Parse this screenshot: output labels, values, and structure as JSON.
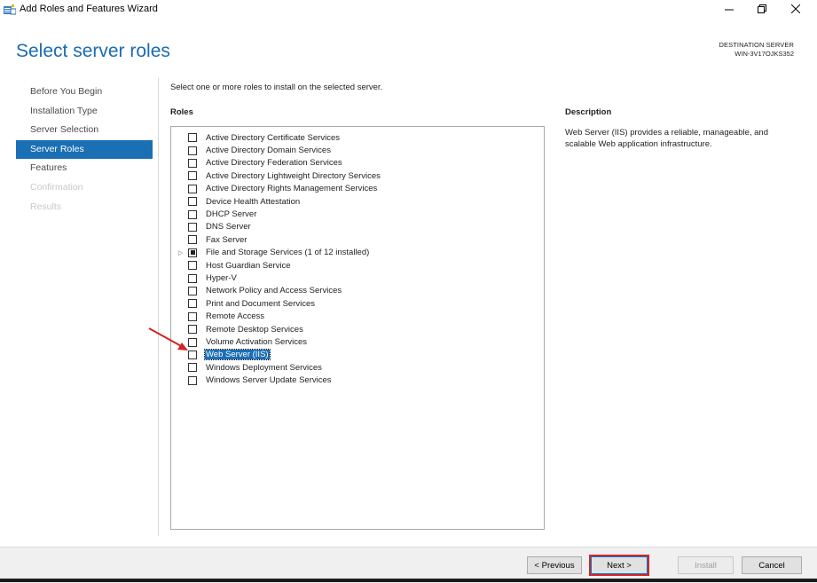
{
  "window": {
    "title": "Add Roles and Features Wizard"
  },
  "header": {
    "page_title": "Select server roles",
    "destination_label": "DESTINATION SERVER",
    "destination_value": "WIN-3V17OJKS352"
  },
  "nav": {
    "items": [
      {
        "label": "Before You Begin",
        "state": "normal"
      },
      {
        "label": "Installation Type",
        "state": "normal"
      },
      {
        "label": "Server Selection",
        "state": "normal"
      },
      {
        "label": "Server Roles",
        "state": "active"
      },
      {
        "label": "Features",
        "state": "normal"
      },
      {
        "label": "Confirmation",
        "state": "disabled"
      },
      {
        "label": "Results",
        "state": "disabled"
      }
    ]
  },
  "main": {
    "instruction": "Select one or more roles to install on the selected server.",
    "roles_heading": "Roles",
    "roles": [
      {
        "label": "Active Directory Certificate Services",
        "checked": false
      },
      {
        "label": "Active Directory Domain Services",
        "checked": false
      },
      {
        "label": "Active Directory Federation Services",
        "checked": false
      },
      {
        "label": "Active Directory Lightweight Directory Services",
        "checked": false
      },
      {
        "label": "Active Directory Rights Management Services",
        "checked": false
      },
      {
        "label": "Device Health Attestation",
        "checked": false
      },
      {
        "label": "DHCP Server",
        "checked": false
      },
      {
        "label": "DNS Server",
        "checked": false
      },
      {
        "label": "Fax Server",
        "checked": false
      },
      {
        "label": "File and Storage Services (1 of 12 installed)",
        "checked": "partial",
        "expandable": true
      },
      {
        "label": "Host Guardian Service",
        "checked": false
      },
      {
        "label": "Hyper-V",
        "checked": false
      },
      {
        "label": "Network Policy and Access Services",
        "checked": false
      },
      {
        "label": "Print and Document Services",
        "checked": false
      },
      {
        "label": "Remote Access",
        "checked": false
      },
      {
        "label": "Remote Desktop Services",
        "checked": false
      },
      {
        "label": "Volume Activation Services",
        "checked": false
      },
      {
        "label": "Web Server (IIS)",
        "checked": false,
        "selected": true
      },
      {
        "label": "Windows Deployment Services",
        "checked": false
      },
      {
        "label": "Windows Server Update Services",
        "checked": false
      }
    ],
    "description_heading": "Description",
    "description_text": "Web Server (IIS) provides a reliable, manageable, and scalable Web application infrastructure."
  },
  "footer": {
    "previous_label": "< Previous",
    "next_label": "Next >",
    "install_label": "Install",
    "cancel_label": "Cancel"
  },
  "colors": {
    "accent": "#1a6fb5",
    "highlight": "#d32525"
  }
}
